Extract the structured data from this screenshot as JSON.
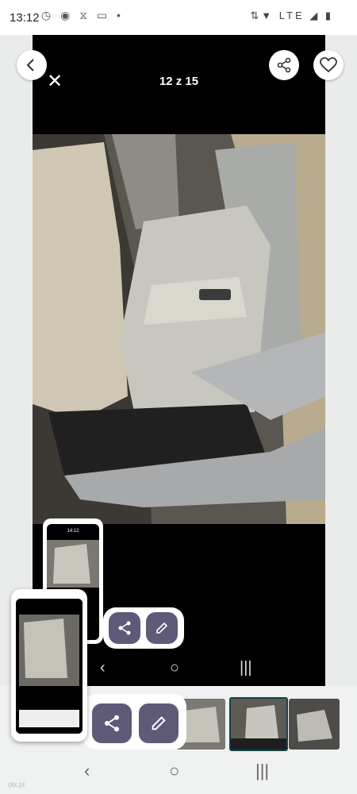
{
  "status_bar": {
    "time": "13:12",
    "network": "LTE"
  },
  "viewer": {
    "counter": "12 z 15",
    "mini_counter": "14:12"
  },
  "icons": {
    "back": "back-arrow-icon",
    "share": "share-icon",
    "favorite": "heart-icon",
    "close": "close-icon",
    "edit": "pencil-icon"
  },
  "colors": {
    "action_button": "#5f5a78",
    "viewer_bg": "#000000"
  },
  "watermark": "olx.pl"
}
